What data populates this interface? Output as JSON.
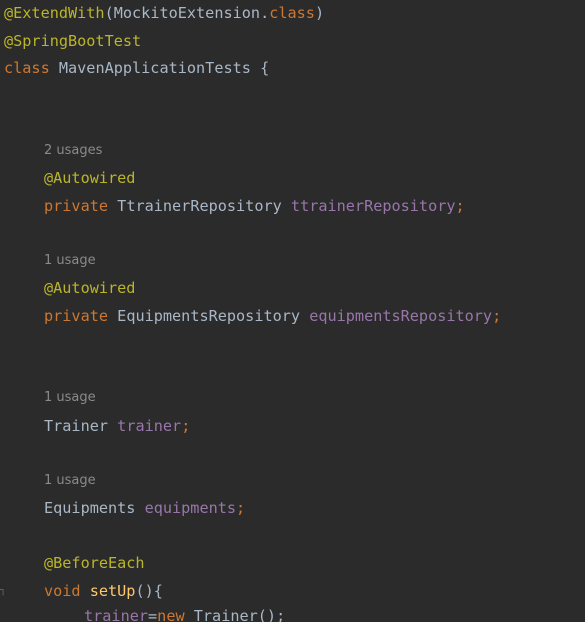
{
  "code": {
    "line1": {
      "ann": "@ExtendWith",
      "open": "(",
      "cls": "MockitoExtension",
      "dot": ".",
      "kw": "class",
      "close": ")"
    },
    "line2": {
      "ann": "@SpringBootTest"
    },
    "line3": {
      "kw": "class",
      "name": "MavenApplicationTests",
      "brace": "{"
    },
    "hint1": "2 usages",
    "line4": {
      "ann": "@Autowired"
    },
    "line5": {
      "kw": "private",
      "type": "TtrainerRepository",
      "field": "ttrainerRepository",
      "semi": ";"
    },
    "hint2": "1 usage",
    "line6": {
      "ann": "@Autowired"
    },
    "line7": {
      "kw": "private",
      "type": "EquipmentsRepository",
      "field": "equipmentsRepository",
      "semi": ";"
    },
    "hint3": "1 usage",
    "line8": {
      "type": "Trainer",
      "field": "trainer",
      "semi": ";"
    },
    "hint4": "1 usage",
    "line9": {
      "type": "Equipments",
      "field": "equipments",
      "semi": ";"
    },
    "line10": {
      "ann": "@BeforeEach"
    },
    "line11": {
      "kw": "void",
      "method": "setUp",
      "parens": "()",
      "brace": "{"
    },
    "line12": {
      "field": "trainer",
      "eq": "=",
      "kw": "new",
      "type": "Trainer",
      "tail": "();"
    }
  },
  "colors": {
    "background": "#2b2b2b",
    "annotation": "#bbb529",
    "keyword": "#cc7832",
    "field": "#9876aa",
    "text": "#a9b7c6",
    "method": "#ffc66d",
    "hint": "#8a8a8a"
  }
}
